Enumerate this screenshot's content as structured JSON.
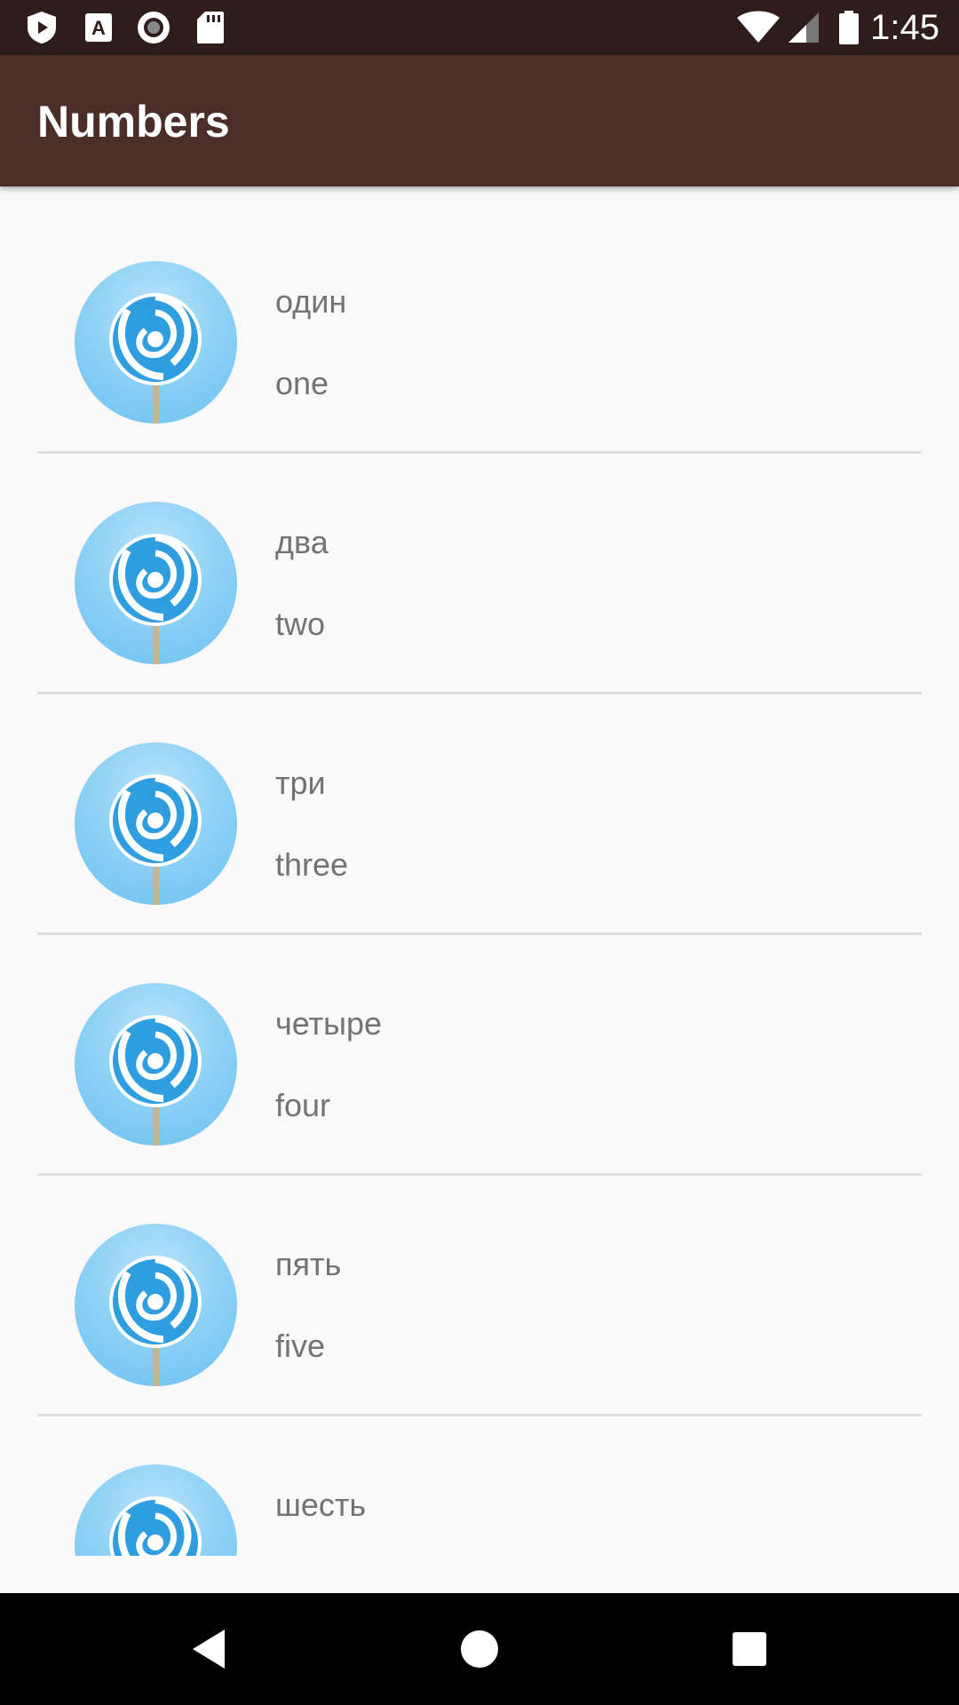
{
  "status_bar": {
    "time": "1:45",
    "left_icons": [
      "shield-play-icon",
      "text-a-icon",
      "record-icon",
      "sd-card-icon"
    ],
    "right_icons": [
      "wifi-icon",
      "signal-icon",
      "battery-icon"
    ]
  },
  "app_bar": {
    "title": "Numbers"
  },
  "list": {
    "items": [
      {
        "ru": "один",
        "en": "one",
        "icon": "lollipop-icon"
      },
      {
        "ru": "два",
        "en": "two",
        "icon": "lollipop-icon"
      },
      {
        "ru": "три",
        "en": "three",
        "icon": "lollipop-icon"
      },
      {
        "ru": "четыре",
        "en": "four",
        "icon": "lollipop-icon"
      },
      {
        "ru": "пять",
        "en": "five",
        "icon": "lollipop-icon"
      },
      {
        "ru": "шесть",
        "en": "",
        "icon": "lollipop-icon"
      }
    ]
  },
  "nav_bar": {
    "buttons": [
      "back-icon",
      "home-icon",
      "recents-icon"
    ]
  },
  "colors": {
    "status_bar": "#2e1d1a",
    "app_bar": "#4b2e28",
    "background": "#f9f9f9",
    "text": "#737373",
    "avatar": "#8fd2f6"
  }
}
